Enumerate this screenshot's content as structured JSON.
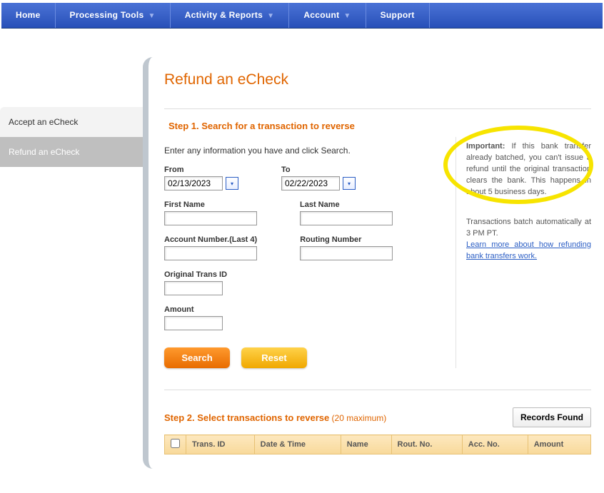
{
  "nav": {
    "items": [
      {
        "label": "Home",
        "dropdown": false
      },
      {
        "label": "Processing Tools",
        "dropdown": true
      },
      {
        "label": "Activity & Reports",
        "dropdown": true
      },
      {
        "label": "Account",
        "dropdown": true
      },
      {
        "label": "Support",
        "dropdown": false
      }
    ]
  },
  "sidebar": {
    "items": [
      {
        "label": "Accept an eCheck",
        "active": false
      },
      {
        "label": "Refund an eCheck",
        "active": true
      }
    ]
  },
  "page": {
    "title": "Refund an eCheck"
  },
  "step1": {
    "title": "Step 1. Search for a transaction to reverse",
    "instruction": "Enter any information you have and click Search.",
    "fields": {
      "from_label": "From",
      "from_value": "02/13/2023",
      "to_label": "To",
      "to_value": "02/22/2023",
      "first_name_label": "First Name",
      "first_name_value": "",
      "last_name_label": "Last Name",
      "last_name_value": "",
      "account_last4_label": "Account Number.(Last 4)",
      "account_last4_value": "",
      "routing_label": "Routing Number",
      "routing_value": "",
      "orig_trans_label": "Original Trans ID",
      "orig_trans_value": "",
      "amount_label": "Amount",
      "amount_value": ""
    },
    "buttons": {
      "search": "Search",
      "reset": "Reset"
    },
    "info": {
      "important_label": "Important:",
      "important_text": " If this bank transfer already batched, you can't issue a refund until the original transaction clears the bank. This happens in about 5 business days.",
      "batch_note": "Transactions batch automatically at 3 PM PT.",
      "link_text": "Learn more about how refunding bank transfers work."
    }
  },
  "step2": {
    "title": "Step 2. Select transactions to reverse",
    "max_note": "  (20 maximum)",
    "records_button": "Records Found",
    "columns": [
      "Trans. ID",
      "Date & Time",
      "Name",
      "Rout. No.",
      "Acc. No.",
      "Amount"
    ]
  }
}
